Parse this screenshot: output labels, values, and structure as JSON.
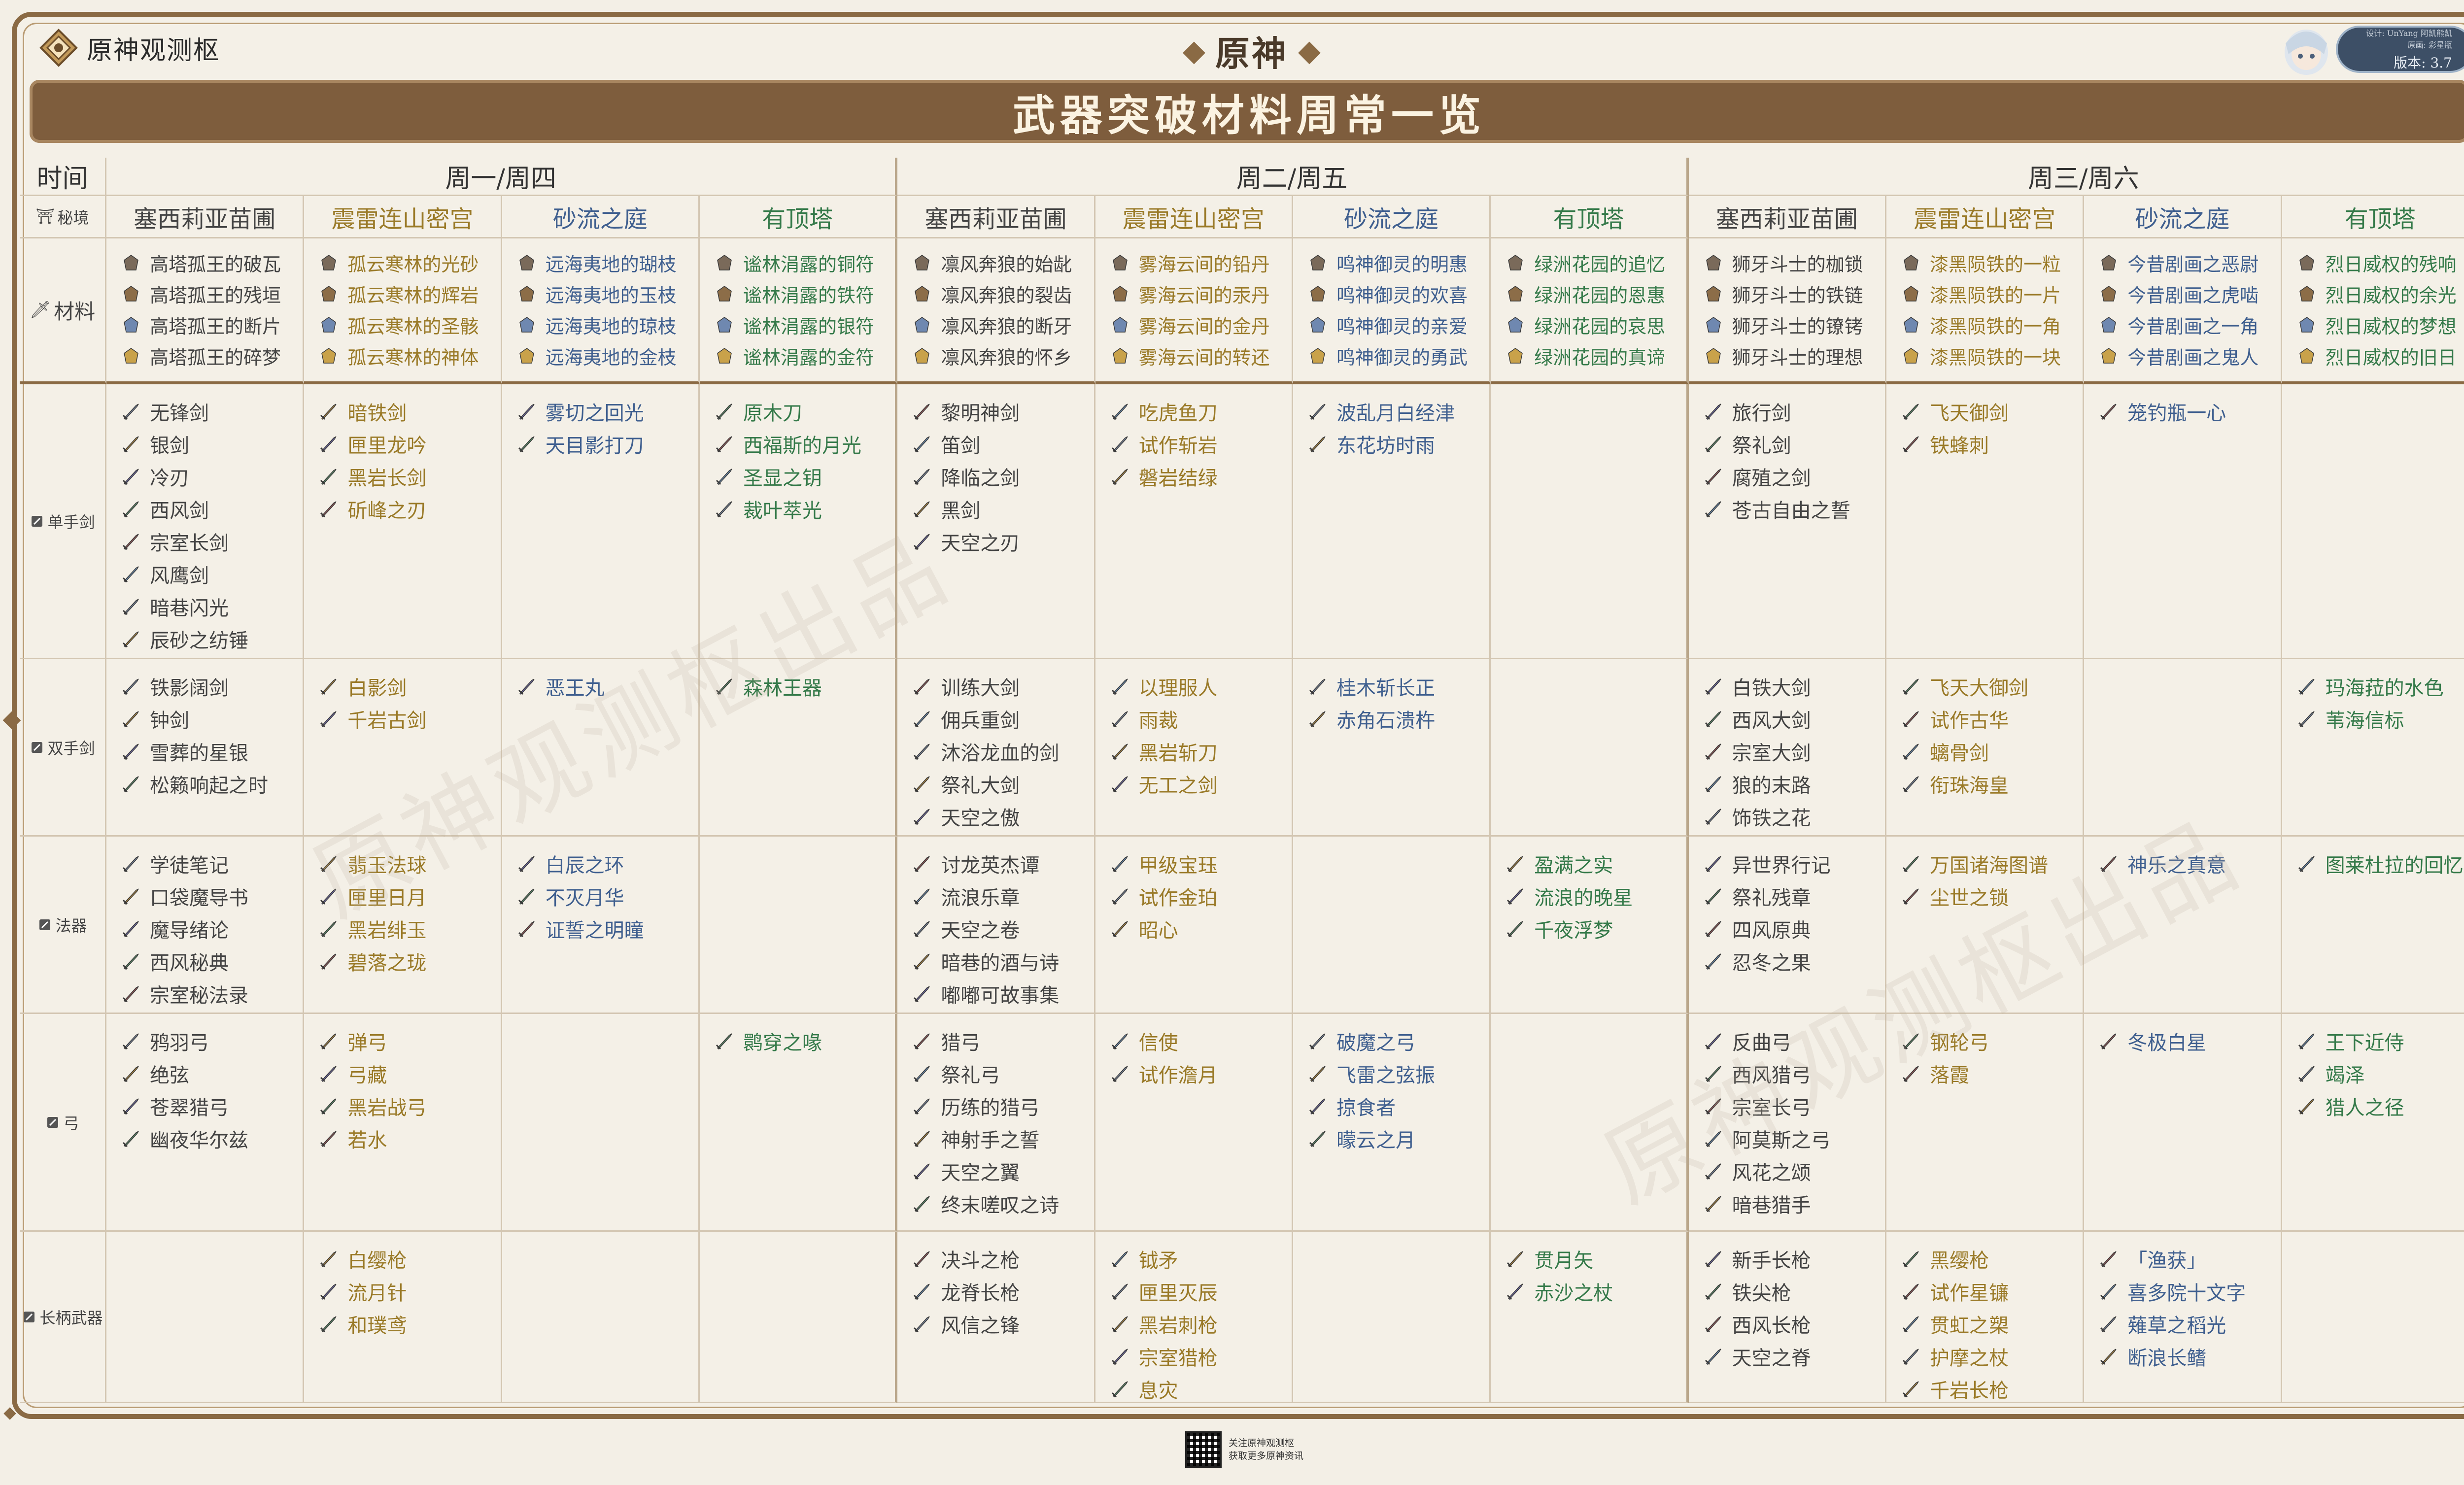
{
  "brand": {
    "name": "原神观测枢"
  },
  "game_logo": {
    "text": "原神"
  },
  "version_badge": {
    "line1": "设计: UnYang 阿凯熊凯",
    "line2": "原画: 彩星瓶",
    "version": "版本: 3.7"
  },
  "title": "武器突破材料周常一览",
  "labels": {
    "time": "时间",
    "domain": "秘境",
    "materials": "材料"
  },
  "days": [
    "周一/周四",
    "周二/周五",
    "周三/周六"
  ],
  "domains": [
    "塞西莉亚苗圃",
    "震雷连山密宫",
    "砂流之庭",
    "有顶塔"
  ],
  "domain_colors": [
    "#444444",
    "#9a7a28",
    "#3f5f8f",
    "#357a4a"
  ],
  "materials": [
    [
      "高塔孤王的破瓦",
      "高塔孤王的残垣",
      "高塔孤王的断片",
      "高塔孤王的碎梦"
    ],
    [
      "孤云寒林的光砂",
      "孤云寒林的辉岩",
      "孤云寒林的圣骸",
      "孤云寒林的神体"
    ],
    [
      "远海夷地的瑚枝",
      "远海夷地的玉枝",
      "远海夷地的琼枝",
      "远海夷地的金枝"
    ],
    [
      "谧林涓露的铜符",
      "谧林涓露的铁符",
      "谧林涓露的银符",
      "谧林涓露的金符"
    ],
    [
      "凛风奔狼的始龀",
      "凛风奔狼的裂齿",
      "凛风奔狼的断牙",
      "凛风奔狼的怀乡"
    ],
    [
      "雾海云间的铅丹",
      "雾海云间的汞丹",
      "雾海云间的金丹",
      "雾海云间的转还"
    ],
    [
      "鸣神御灵的明惠",
      "鸣神御灵的欢喜",
      "鸣神御灵的亲爱",
      "鸣神御灵的勇武"
    ],
    [
      "绿洲花园的追忆",
      "绿洲花园的恩惠",
      "绿洲花园的哀思",
      "绿洲花园的真谛"
    ],
    [
      "狮牙斗士的枷锁",
      "狮牙斗士的铁链",
      "狮牙斗士的镣铐",
      "狮牙斗士的理想"
    ],
    [
      "漆黑陨铁的一粒",
      "漆黑陨铁的一片",
      "漆黑陨铁的一角",
      "漆黑陨铁的一块"
    ],
    [
      "今昔剧画之恶尉",
      "今昔剧画之虎啮",
      "今昔剧画之一角",
      "今昔剧画之鬼人"
    ],
    [
      "烈日威权的残响",
      "烈日威权的余光",
      "烈日威权的梦想",
      "烈日威权的旧日"
    ]
  ],
  "weapon_types": [
    "单手剑",
    "双手剑",
    "法器",
    "弓",
    "长柄武器"
  ],
  "weapons": [
    [
      [
        "无锋剑",
        "银剑",
        "冷刃",
        "西风剑",
        "宗室长剑",
        "风鹰剑",
        "暗巷闪光",
        "辰砂之纺锤"
      ],
      [
        "暗铁剑",
        "匣里龙吟",
        "黑岩长剑",
        "斫峰之刃"
      ],
      [
        "雾切之回光",
        "天目影打刀"
      ],
      [
        "原木刀",
        "西福斯的月光",
        "圣显之钥",
        "裁叶萃光"
      ],
      [
        "黎明神剑",
        "笛剑",
        "降临之剑",
        "黑剑",
        "天空之刃"
      ],
      [
        "吃虎鱼刀",
        "试作斩岩",
        "磐岩结绿"
      ],
      [
        "波乱月白经津",
        "东花坊时雨"
      ],
      [],
      [
        "旅行剑",
        "祭礼剑",
        "腐殖之剑",
        "苍古自由之誓"
      ],
      [
        "飞天御剑",
        "铁蜂刺"
      ],
      [
        "笼钓瓶一心"
      ],
      []
    ],
    [
      [
        "铁影阔剑",
        "钟剑",
        "雪葬的星银",
        "松籁响起之时"
      ],
      [
        "白影剑",
        "千岩古剑"
      ],
      [
        "恶王丸"
      ],
      [
        "森林王器"
      ],
      [
        "训练大剑",
        "佣兵重剑",
        "沐浴龙血的剑",
        "祭礼大剑",
        "天空之傲"
      ],
      [
        "以理服人",
        "雨裁",
        "黑岩斩刀",
        "无工之剑"
      ],
      [
        "桂木斩长正",
        "赤角石溃杵"
      ],
      [],
      [
        "白铁大剑",
        "西风大剑",
        "宗室大剑",
        "狼的末路",
        "饰铁之花"
      ],
      [
        "飞天大御剑",
        "试作古华",
        "螭骨剑",
        "衔珠海皇"
      ],
      [],
      [
        "玛海菈的水色",
        "苇海信标"
      ]
    ],
    [
      [
        "学徒笔记",
        "口袋魔导书",
        "魔导绪论",
        "西风秘典",
        "宗室秘法录"
      ],
      [
        "翡玉法球",
        "匣里日月",
        "黑岩绯玉",
        "碧落之珑"
      ],
      [
        "白辰之环",
        "不灭月华",
        "证誓之明瞳"
      ],
      [],
      [
        "讨龙英杰谭",
        "流浪乐章",
        "天空之卷",
        "暗巷的酒与诗",
        "嘟嘟可故事集"
      ],
      [
        "甲级宝珏",
        "试作金珀",
        "昭心"
      ],
      [],
      [
        "盈满之实",
        "流浪的晚星",
        "千夜浮梦"
      ],
      [
        "异世界行记",
        "祭礼残章",
        "四风原典",
        "忍冬之果"
      ],
      [
        "万国诸海图谱",
        "尘世之锁"
      ],
      [
        "神乐之真意"
      ],
      [
        "图莱杜拉的回忆"
      ]
    ],
    [
      [
        "鸦羽弓",
        "绝弦",
        "苍翠猎弓",
        "幽夜华尔兹"
      ],
      [
        "弹弓",
        "弓藏",
        "黑岩战弓",
        "若水"
      ],
      [],
      [
        "鹮穿之喙"
      ],
      [
        "猎弓",
        "祭礼弓",
        "历练的猎弓",
        "神射手之誓",
        "天空之翼",
        "终末嗟叹之诗"
      ],
      [
        "信使",
        "试作澹月"
      ],
      [
        "破魔之弓",
        "飞雷之弦振",
        "掠食者",
        "曚云之月"
      ],
      [],
      [
        "反曲弓",
        "西风猎弓",
        "宗室长弓",
        "阿莫斯之弓",
        "风花之颂",
        "暗巷猎手"
      ],
      [
        "钢轮弓",
        "落霞"
      ],
      [
        "冬极白星"
      ],
      [
        "王下近侍",
        "竭泽",
        "猎人之径"
      ]
    ],
    [
      [],
      [
        "白缨枪",
        "流月针",
        "和璞鸢"
      ],
      [],
      [],
      [
        "决斗之枪",
        "龙脊长枪",
        "风信之锋"
      ],
      [
        "钺矛",
        "匣里灭辰",
        "黑岩刺枪",
        "宗室猎枪",
        "息灾"
      ],
      [],
      [
        "贯月矢",
        "赤沙之杖"
      ],
      [
        "新手长枪",
        "铁尖枪",
        "西风长枪",
        "天空之脊"
      ],
      [
        "黑缨枪",
        "试作星镰",
        "贯虹之槊",
        "护摩之杖",
        "千岩长枪"
      ],
      [
        "「渔获」",
        "喜多院十文字",
        "薙草之稻光",
        "断浪长鳍"
      ],
      []
    ]
  ],
  "footer": {
    "line1": "关注原神观测枢",
    "line2": "获取更多原神资讯"
  },
  "watermark": "原神观测枢出品"
}
